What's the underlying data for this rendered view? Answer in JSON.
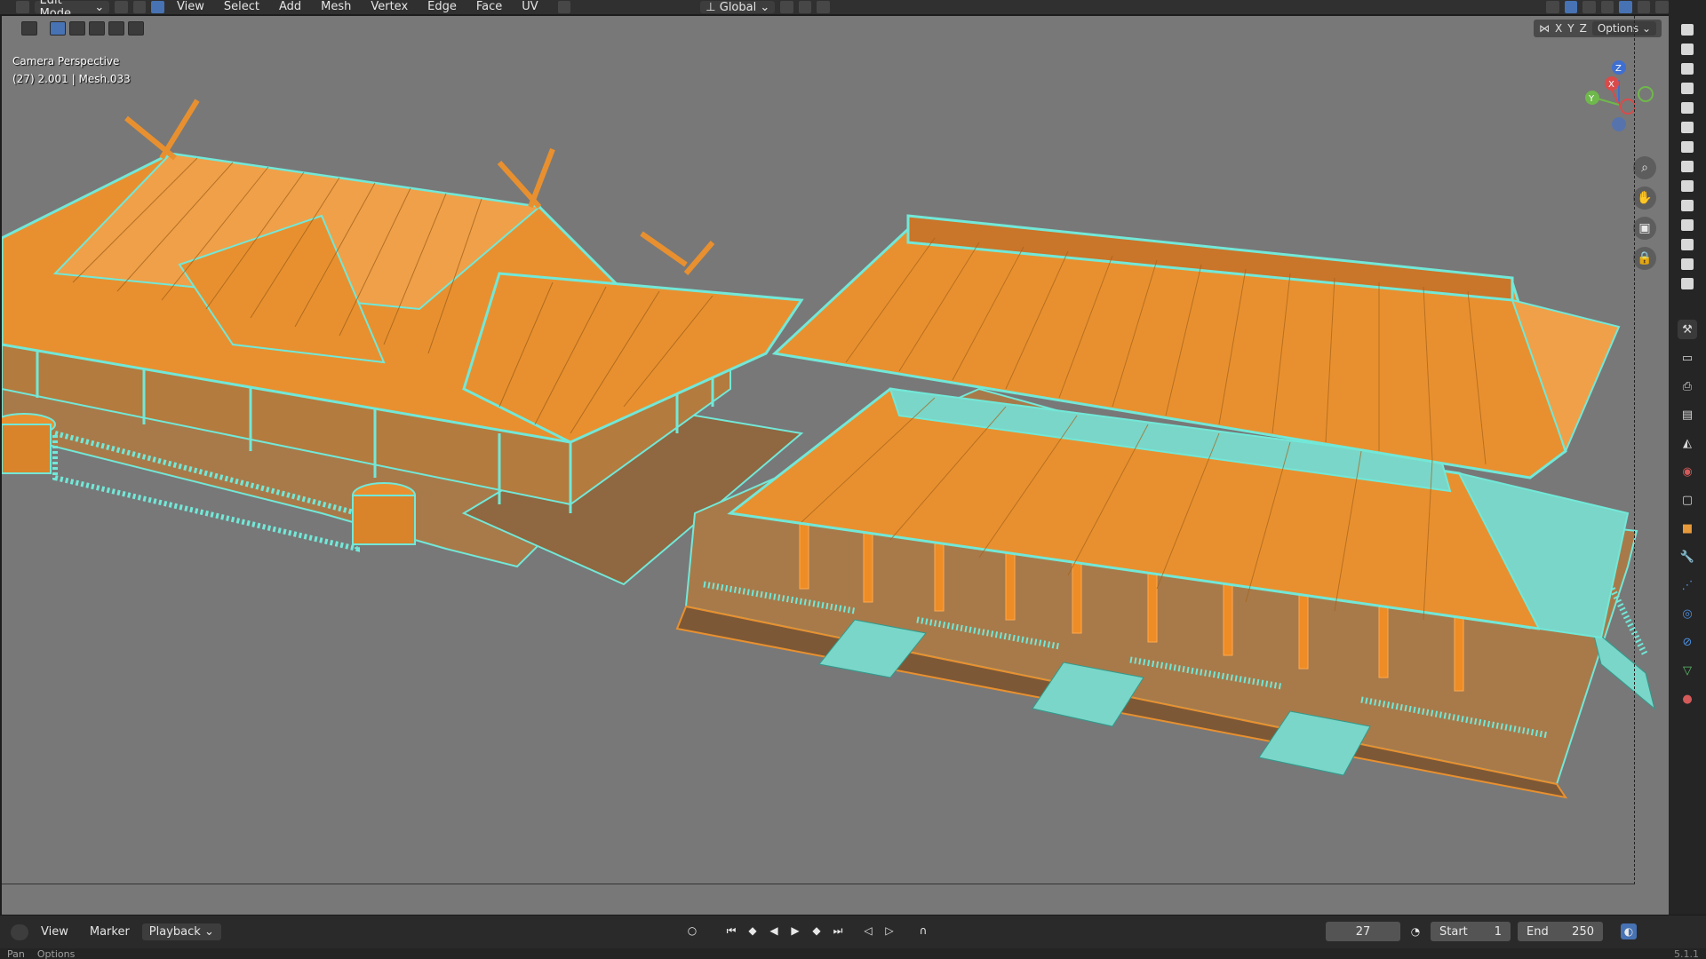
{
  "header": {
    "mode_label": "Edit Mode",
    "menus": [
      "View",
      "Select",
      "Add",
      "Mesh",
      "Vertex",
      "Edge",
      "Face",
      "UV"
    ],
    "transform_orientation": "Global",
    "options_label": "Options",
    "axis_labels": [
      "X",
      "Y",
      "Z"
    ]
  },
  "viewport": {
    "view_name": "Camera Perspective",
    "object_info": "(27) 2.001 | Mesh.033",
    "gizmo_axes": [
      "Z",
      "X",
      "Y"
    ],
    "colors": {
      "background": "#787878",
      "roof_fill": "#e8902f",
      "edge_select": "#72e8d8",
      "wall_fill": "#a87a4a"
    }
  },
  "timeline": {
    "menus": [
      "View",
      "Marker"
    ],
    "playback_label": "Playback",
    "current_frame": "27",
    "start_label": "Start",
    "start_value": "1",
    "end_label": "End",
    "end_value": "250"
  },
  "status": {
    "left_hint": "Pan",
    "right_hint": "Options",
    "version": "5.1.1"
  },
  "icons": {
    "header": [
      "editor-type-icon",
      "vertex-select-icon",
      "edge-select-icon",
      "face-select-icon"
    ],
    "navigation": [
      "zoom-icon",
      "hand-pan-icon",
      "camera-view-icon",
      "lock-icon"
    ]
  }
}
